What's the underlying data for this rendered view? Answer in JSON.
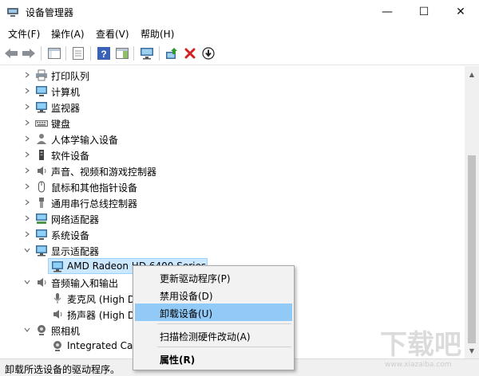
{
  "window": {
    "title": "设备管理器"
  },
  "window_buttons": {
    "minimize": "—",
    "maximize": "☐",
    "close": "✕"
  },
  "menu": [
    "文件(F)",
    "操作(A)",
    "查看(V)",
    "帮助(H)"
  ],
  "tree": [
    {
      "label": "打印队列",
      "icon": "printer-icon"
    },
    {
      "label": "计算机",
      "icon": "computer-icon"
    },
    {
      "label": "监视器",
      "icon": "monitor-icon"
    },
    {
      "label": "键盘",
      "icon": "keyboard-icon"
    },
    {
      "label": "人体学输入设备",
      "icon": "hid-icon"
    },
    {
      "label": "软件设备",
      "icon": "software-device-icon"
    },
    {
      "label": "声音、视频和游戏控制器",
      "icon": "speaker-icon"
    },
    {
      "label": "鼠标和其他指针设备",
      "icon": "mouse-icon"
    },
    {
      "label": "通用串行总线控制器",
      "icon": "usb-icon"
    },
    {
      "label": "网络适配器",
      "icon": "network-icon"
    },
    {
      "label": "系统设备",
      "icon": "system-icon"
    },
    {
      "label": "显示适配器",
      "icon": "display-adapter-icon"
    },
    {
      "label": "AMD Radeon HD 6400 Series",
      "icon": "gpu-icon"
    },
    {
      "label": "音频输入和输出",
      "icon": "audio-icon"
    },
    {
      "label": "麦克风 (High Definition Audio Device)",
      "icon": "microphone-icon"
    },
    {
      "label": "扬声器 (High Definition Audio Device)",
      "icon": "speaker-device-icon"
    },
    {
      "label": "照相机",
      "icon": "camera-icon"
    },
    {
      "label": "Integrated Camera",
      "icon": "webcam-icon"
    }
  ],
  "context_menu": {
    "update_driver": "更新驱动程序(P)",
    "disable": "禁用设备(D)",
    "uninstall": "卸载设备(U)",
    "scan": "扫描检测硬件改动(A)",
    "properties": "属性(R)"
  },
  "status": {
    "text": "卸载所选设备的驱动程序。"
  },
  "watermark": {
    "text": "下载吧",
    "sub": "www.xiazaiba.com"
  },
  "colors": {
    "selection": "#cce8ff",
    "menu_highlight": "#91c9f7",
    "scrollbar_thumb": "#c2c2c2"
  }
}
